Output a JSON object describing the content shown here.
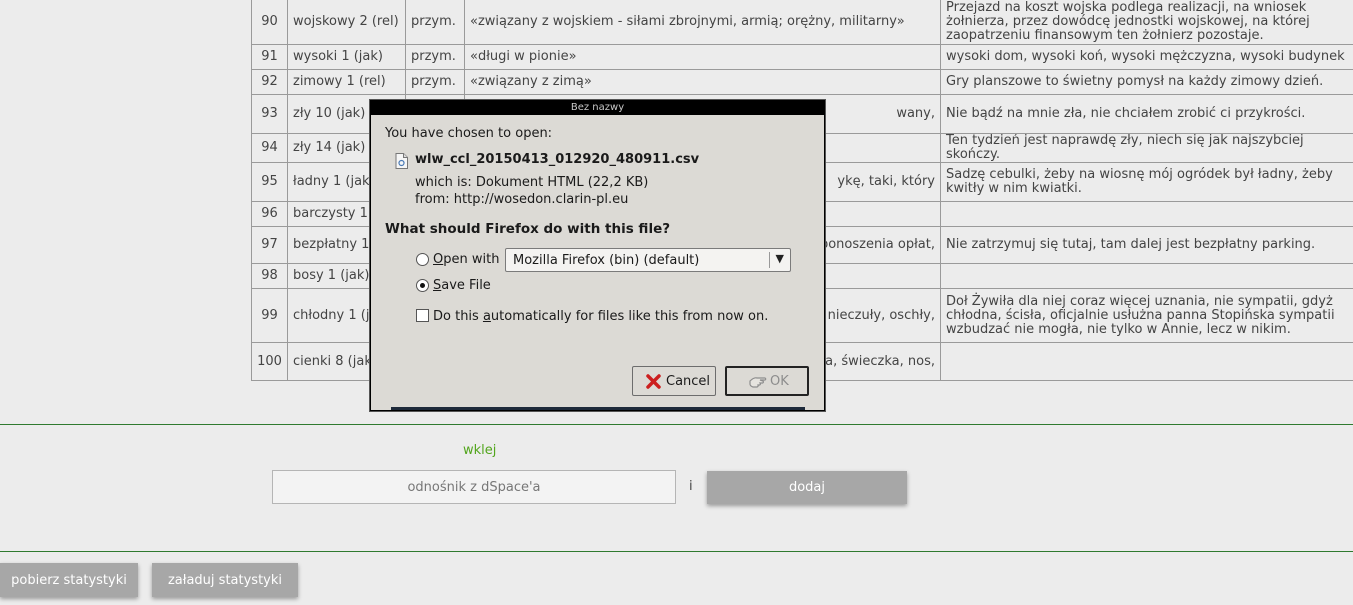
{
  "table": {
    "rows": [
      {
        "num": "90",
        "lemma": "wojskowy 2 (rel)",
        "pos": "przym.",
        "def": "«związany z wojskiem - siłami zbrojnymi, armią; orężny, militarny»",
        "example": "Przejazd na koszt wojska podlega realizacji, na wniosek żołnierza, przez dowódcę jednostki wojskowej, na której zaopatrzeniu finansowym ten żołnierz pozostaje."
      },
      {
        "num": "91",
        "lemma": "wysoki 1 (jak)",
        "pos": "przym.",
        "def": "«długi w pionie»",
        "example": "wysoki dom, wysoki koń, wysoki mężczyzna, wysoki budynek"
      },
      {
        "num": "92",
        "lemma": "zimowy 1 (rel)",
        "pos": "przym.",
        "def": "«związany z zimą»",
        "example": "Gry planszowe to świetny pomysł na każdy zimowy dzień."
      },
      {
        "num": "93",
        "lemma": "zły 10 (jak)",
        "pos": "",
        "def": "wany,",
        "example": "Nie bądź na mnie zła, nie chciałem zrobić ci przykrości."
      },
      {
        "num": "94",
        "lemma": "zły 14 (jak)",
        "pos": "",
        "def": "",
        "example": "Ten tydzień jest naprawdę zły, niech się jak najszybciej skończy."
      },
      {
        "num": "95",
        "lemma": "ładny 1 (jak)",
        "pos": "",
        "def": "ykę, taki, który",
        "example": "Sadzę cebulki, żeby na wiosnę mój ogródek był ładny, żeby kwitły w nim kwiatki."
      },
      {
        "num": "96",
        "lemma": "barczysty 1 (",
        "pos": "",
        "def": "",
        "example": ""
      },
      {
        "num": "97",
        "lemma": "bezpłatny 1 (",
        "pos": "",
        "def": "ponoszenia opłat,",
        "example": "Nie zatrzymuj się tutaj, tam dalej jest bezpłatny parking."
      },
      {
        "num": "98",
        "lemma": "bosy 1 (jak)",
        "pos": "",
        "def": "",
        "example": ""
      },
      {
        "num": "99",
        "lemma": "chłodny 1 (ja",
        "pos": "",
        "def": "nieczuły, oschły,",
        "example": "Doł Żywiła dla niej coraz więcej uznania, nie sympatii, gdyż chłodna, ścisła, oficjalnie usłużna panna Stopińska sympatii wzbudzać nie mogła, nie tylko w Annie, lecz w nikim."
      },
      {
        "num": "100",
        "lemma": "cienki 8 (jak)",
        "pos": "",
        "def": "ia, świeczka, nos,",
        "example": ""
      }
    ]
  },
  "upload": {
    "wklej_label": "wklej",
    "dspace_placeholder": "odnośnik z dSpace'a",
    "and_label": "i",
    "add_button": "dodaj"
  },
  "footer": {
    "download_stats": "pobierz statystyki",
    "load_stats": "załaduj statystyki"
  },
  "dialog": {
    "title": "Bez nazwy",
    "chosen_label": "You have chosen to open:",
    "file_name": "wlw_ccl_20150413_012920_480911.csv",
    "which_is_label": "which is:",
    "which_is_value": "Dokument HTML (22,2 KB)",
    "from_label": "from:",
    "from_value": "http://wosedon.clarin-pl.eu",
    "question": "What should Firefox do with this file?",
    "open_with_label_pre": "",
    "open_with_label_u": "O",
    "open_with_label_post": "pen with",
    "open_with_app": "Mozilla Firefox (bin) (default)",
    "save_file_label_u": "S",
    "save_file_label_post": "ave File",
    "selected_option": "save",
    "auto_label_pre": "Do this ",
    "auto_label_u": "a",
    "auto_label_post": "utomatically for files like this from now on.",
    "auto_checked": false,
    "cancel_label": "Cancel",
    "ok_label": "OK"
  },
  "colors": {
    "accent_green": "#52a51c",
    "divider_green": "#2f7a2f",
    "button_grey": "#a7a7a7",
    "dialog_bg": "#dcdad5",
    "cancel_icon_red": "#cc1f1f"
  }
}
